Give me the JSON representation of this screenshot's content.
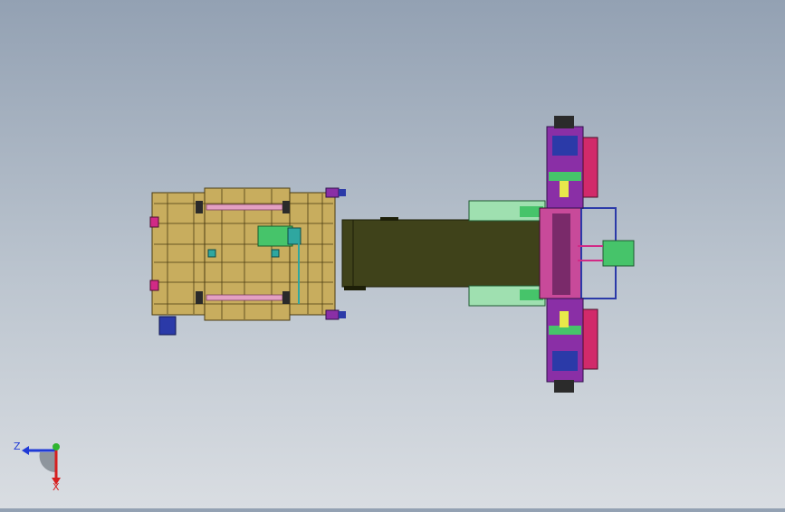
{
  "viewport": {
    "background_top": "#93a1b3",
    "background_bottom": "#d9dde2"
  },
  "triad": {
    "z_label": "Z",
    "x_label": "X",
    "z_color": "#1f3ad6",
    "x_color": "#d61f1f",
    "y_color": "#2fb52f"
  },
  "colors": {
    "tan": "#c8ad5e",
    "tan_dark": "#6e5a22",
    "olive": "#3f421a",
    "magenta": "#d12a86",
    "purple": "#8a2fa6",
    "green": "#46c46a",
    "teal": "#2fa7a0",
    "pink": "#e3a0c2",
    "blue": "#2b3aa8"
  },
  "model": {
    "icons": [
      "assembly-icon",
      "conveyor-icon",
      "gripper-icon",
      "motor-icon"
    ]
  }
}
